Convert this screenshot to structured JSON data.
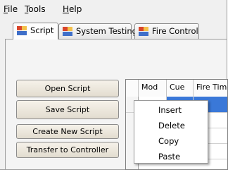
{
  "menu": {
    "file": "File",
    "tools": "Tools",
    "help": "Help"
  },
  "tabs": [
    {
      "label": "Script",
      "active": true
    },
    {
      "label": "System Testing",
      "active": false
    },
    {
      "label": "Fire Control",
      "active": false
    }
  ],
  "buttons": {
    "open": "Open Script",
    "save": "Save Script",
    "create": "Create New Script",
    "transfer": "Transfer to Controller"
  },
  "grid": {
    "columns": [
      "Mod",
      "Cue",
      "Fire Time"
    ],
    "selected_row_color": "#3a78d8"
  },
  "context_menu": {
    "items": [
      "Insert",
      "Delete",
      "Copy",
      "Paste"
    ]
  }
}
